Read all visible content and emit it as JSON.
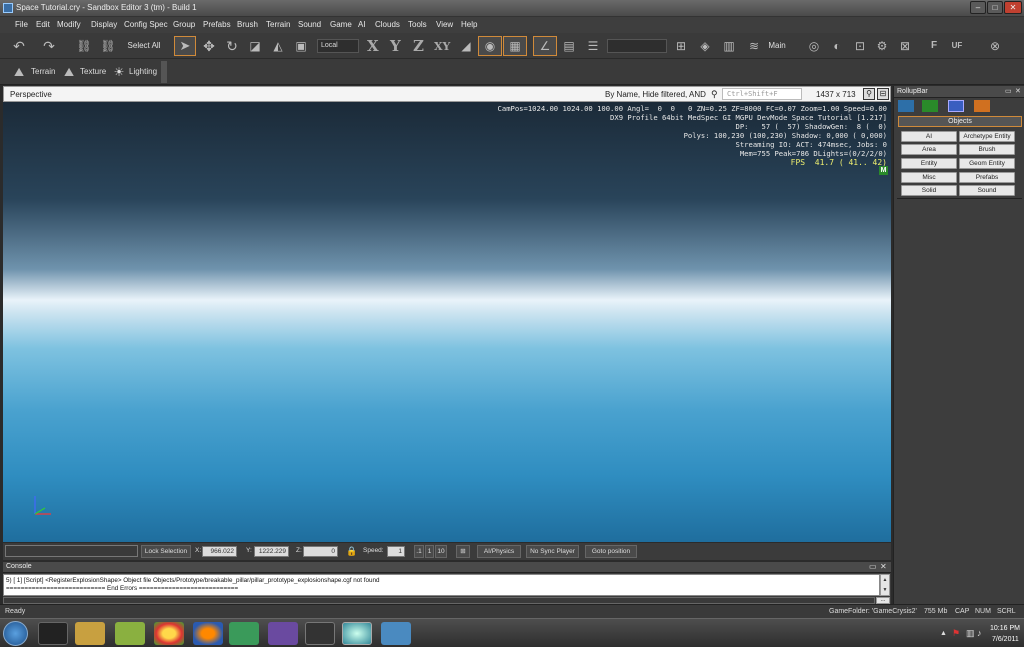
{
  "window": {
    "title": "Space Tutorial.cry - Sandbox Editor 3 (tm) - Build 1"
  },
  "menu": [
    "File",
    "Edit",
    "Modify",
    "Display",
    "Config Spec",
    "Group",
    "Prefabs",
    "Brush",
    "Terrain",
    "Sound",
    "Game",
    "AI",
    "Clouds",
    "Tools",
    "View",
    "Help"
  ],
  "toolbar": {
    "select_all": "Select All",
    "coord_space": "Local",
    "axes": [
      "X",
      "Y",
      "Z",
      "XY"
    ],
    "layer": "Main",
    "mode_buttons": [
      "Terrain",
      "Texture",
      "Lighting"
    ]
  },
  "viewport": {
    "label": "Perspective",
    "search_filter": "By Name, Hide filtered, AND",
    "search_placeholder": "Ctrl+Shift+F",
    "resolution": "1437 x 713",
    "hud": [
      "CamPos=1024.00 1024.00 100.00 Angl=  0  0   0 ZN=0.25 ZF=8000 FC=0.07 Zoom=1.00 Speed=0.00",
      "DX9 Profile 64bit MedSpec GI MGPU DevMode Space Tutorial [1.217]",
      "DP:   57 (  57) ShadowGen:  8 (  0)",
      "Polys: 100,230 (100,230) Shadow: 0,000 ( 0,000)",
      "Streaming IO: ACT: 474msec, Jobs: 0",
      "Mem=755 Peak=786 DLights=(0/2/2/0)"
    ],
    "fps": "FPS  41.7 ( 41.. 42)",
    "mode_badge": "M"
  },
  "viewport_controls": {
    "lock_selection": "Lock Selection",
    "x_label": "X:",
    "x_value": "966.022",
    "y_label": "Y:",
    "y_value": "1222.229",
    "z_label": "Z:",
    "z_value": "0",
    "speed_label": "Speed:",
    "speed_value": "1",
    "speed_presets": [
      ".1",
      "1",
      "10"
    ],
    "ai_physics": "AI/Physics",
    "no_sync": "No Sync Player",
    "goto": "Goto position"
  },
  "console": {
    "title": "Console",
    "lines": [
      "5) [ 1]   [Script]    <RegisterExplosionShape> Object file Objects/Prototype/breakable_pillar/pillar_prototype_explosionshape.cgf not found",
      "=========================== End Errors ==========================="
    ],
    "more": "..."
  },
  "rollup": {
    "title": "RollupBar",
    "section": "Objects",
    "buttons": [
      "AI",
      "Archetype Entity",
      "Area",
      "Brush",
      "Entity",
      "Geom Entity",
      "Misc",
      "Prefabs",
      "Solid",
      "Sound"
    ]
  },
  "status": {
    "ready": "Ready",
    "game_folder": "GameFolder: 'GameCrysis2'",
    "memory": "755 Mb",
    "caps": "CAP",
    "num": "NUM",
    "scrl": "SCRL"
  },
  "taskbar": {
    "time": "10:16 PM",
    "date": "7/6/2011"
  }
}
